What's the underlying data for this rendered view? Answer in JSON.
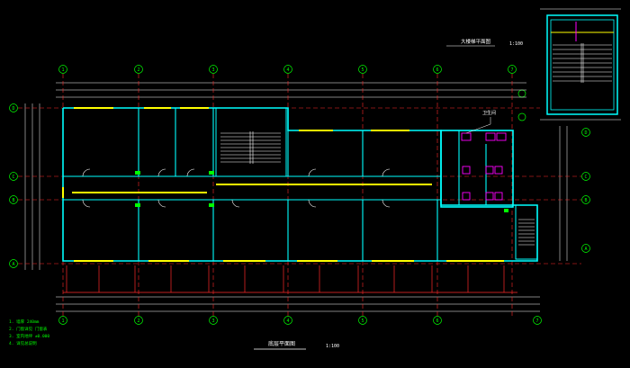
{
  "drawing": {
    "main_title": "底层平面图",
    "main_scale": "1:100",
    "inset_title": "大楼梯平面图",
    "inset_scale": "1:100",
    "annotation": "卫生间",
    "axis_labels_top": [
      "1",
      "2",
      "3",
      "4",
      "5",
      "6",
      "7"
    ],
    "axis_labels_left": [
      "D",
      "C",
      "B",
      "A"
    ],
    "axis_labels_right": [
      "D",
      "C",
      "B",
      "A"
    ],
    "notes": [
      "1. 墙厚 240mm",
      "2. 门窗详见 门窗表",
      "3. 室内地坪 ±0.000",
      "4. 详见总说明"
    ]
  },
  "colors": {
    "background": "#000000",
    "wall": "#00ffff",
    "axis": "#00ff00",
    "dimension": "#ffffff",
    "window": "#ffff00",
    "stair": "#ffffff",
    "hidden": "#ff0000",
    "fixture": "#ff00ff"
  }
}
